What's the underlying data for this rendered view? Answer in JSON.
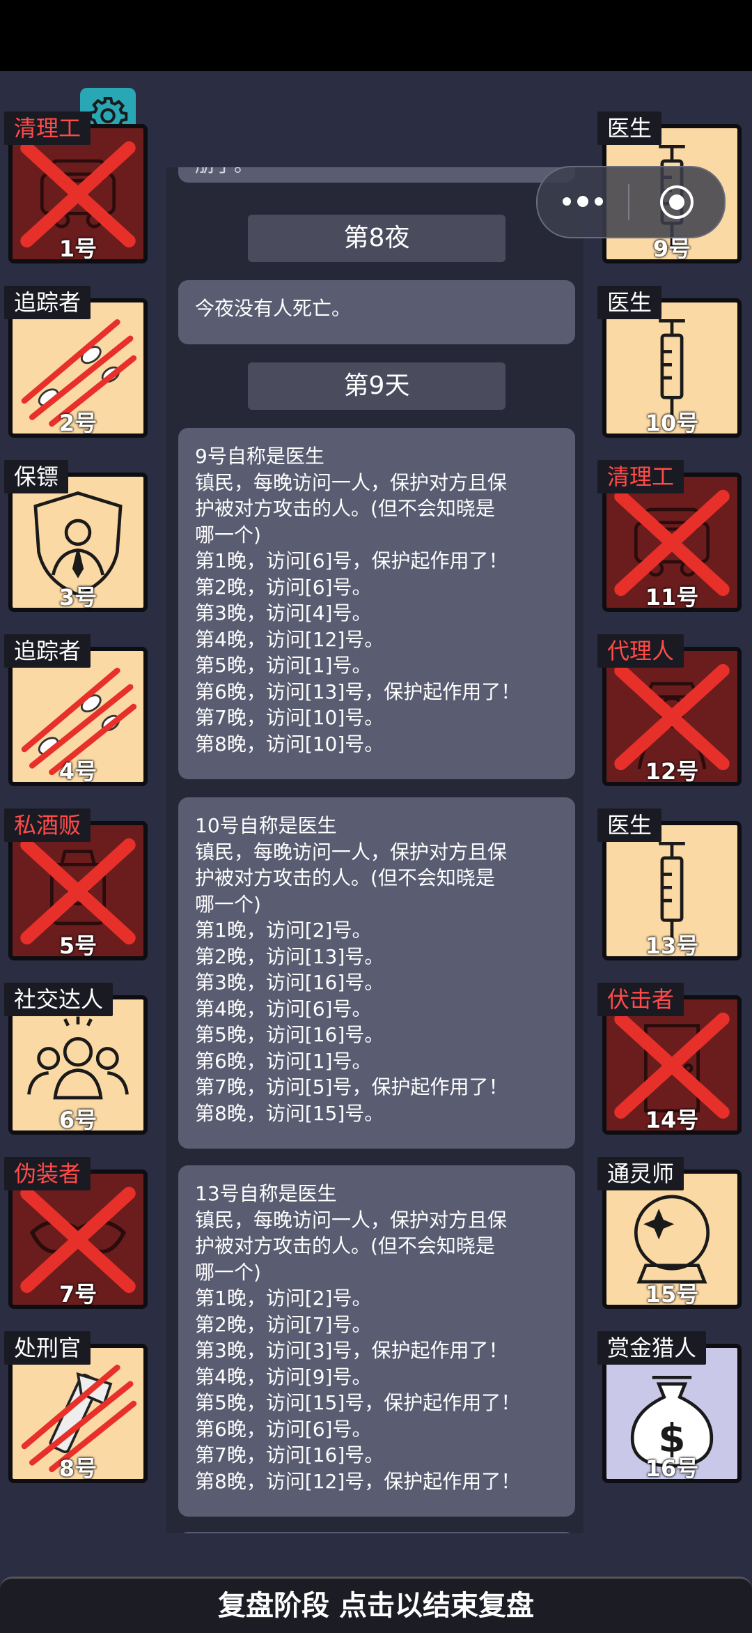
{
  "left_players": [
    {
      "role": "清理工",
      "number": "1号",
      "status": "dead",
      "icon": "car-icon",
      "mark": "x"
    },
    {
      "role": "追踪者",
      "number": "2号",
      "status": "alive",
      "icon": "footprints-icon",
      "mark": "slash"
    },
    {
      "role": "保镖",
      "number": "3号",
      "status": "alive",
      "icon": "bodyguard-shield-icon",
      "mark": "none"
    },
    {
      "role": "追踪者",
      "number": "4号",
      "status": "alive",
      "icon": "footprints-icon",
      "mark": "slash"
    },
    {
      "role": "私酒贩",
      "number": "5号",
      "status": "dead",
      "icon": "bootlegger-icon",
      "mark": "x"
    },
    {
      "role": "社交达人",
      "number": "6号",
      "status": "alive",
      "icon": "group-people-icon",
      "mark": "none"
    },
    {
      "role": "伪装者",
      "number": "7号",
      "status": "dead",
      "icon": "mask-icon",
      "mark": "x"
    },
    {
      "role": "处刑官",
      "number": "8号",
      "status": "alive",
      "icon": "executioner-icon",
      "mark": "slash"
    }
  ],
  "right_players": [
    {
      "role": "医生",
      "number": "9号",
      "status": "alive",
      "icon": "syringe-icon",
      "mark": "none"
    },
    {
      "role": "医生",
      "number": "10号",
      "status": "alive",
      "icon": "syringe-icon",
      "mark": "none"
    },
    {
      "role": "清理工",
      "number": "11号",
      "status": "dead",
      "icon": "car-icon",
      "mark": "x"
    },
    {
      "role": "代理人",
      "number": "12号",
      "status": "dead",
      "icon": "agent-coat-icon",
      "mark": "x"
    },
    {
      "role": "医生",
      "number": "13号",
      "status": "alive",
      "icon": "syringe-icon",
      "mark": "none"
    },
    {
      "role": "伏击者",
      "number": "14号",
      "status": "dead",
      "icon": "door-icon",
      "mark": "x"
    },
    {
      "role": "通灵师",
      "number": "15号",
      "status": "alive",
      "icon": "crystal-ball-icon",
      "mark": "none"
    },
    {
      "role": "赏金猎人",
      "number": "16号",
      "status": "alive",
      "icon": "money-bag-icon",
      "mark": "none"
    }
  ],
  "log": {
    "top_partial": "朋了。",
    "headers": {
      "night8": "第8夜",
      "day9": "第9天"
    },
    "night8_message": "今夜没有人死亡。",
    "claims": [
      {
        "lines": [
          "9号自称是医生",
          "镇民，每晚访问一人，保护对方且保",
          "护被对方攻击的人。(但不会知晓是",
          "哪一个)",
          "第1晚，访问[6]号，保护起作用了！",
          "第2晚，访问[6]号。",
          "第3晚，访问[4]号。",
          "第4晚，访问[12]号。",
          "第5晚，访问[1]号。",
          "第6晚，访问[13]号，保护起作用了！",
          "第7晚，访问[10]号。",
          "第8晚，访问[10]号。"
        ]
      },
      {
        "lines": [
          "10号自称是医生",
          "镇民，每晚访问一人，保护对方且保",
          "护被对方攻击的人。(但不会知晓是",
          "哪一个)",
          "第1晚，访问[2]号。",
          "第2晚，访问[13]号。",
          "第3晚，访问[16]号。",
          "第4晚，访问[6]号。",
          "第5晚，访问[16]号。",
          "第6晚，访问[1]号。",
          "第7晚，访问[5]号，保护起作用了！",
          "第8晚，访问[15]号。"
        ]
      },
      {
        "lines": [
          "13号自称是医生",
          "镇民，每晚访问一人，保护对方且保",
          "护被对方攻击的人。(但不会知晓是",
          "哪一个)",
          "第1晚，访问[2]号。",
          "第2晚，访问[7]号。",
          "第3晚，访问[3]号，保护起作用了！",
          "第4晚，访问[9]号。",
          "第5晚，访问[15]号，保护起作用了！",
          "第6晚，访问[6]号。",
          "第7晚，访问[16]号。",
          "第8晚，访问[12]号，保护起作用了！"
        ]
      }
    ]
  },
  "bottom_bar": "复盘阶段 点击以结束复盘",
  "colors": {
    "background": "#2b2d42",
    "alive_card": "#fbd9a4",
    "dead_card": "#6b1d1d",
    "bounty_card": "#c9c8e8",
    "red_mark": "#e8302a",
    "gear": "#2aa7b4"
  }
}
